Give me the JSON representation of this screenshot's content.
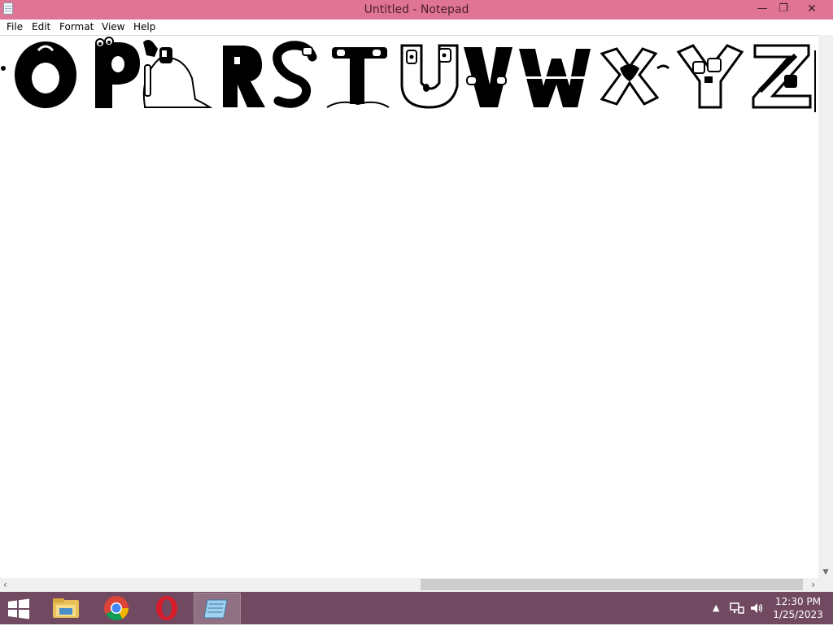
{
  "window": {
    "title": "Untitled - Notepad",
    "app_icon": "notepad-icon",
    "controls": {
      "minimize": "—",
      "maximize": "❐",
      "close": "✕"
    }
  },
  "menu": [
    {
      "label": "File"
    },
    {
      "label": "Edit"
    },
    {
      "label": "Format"
    },
    {
      "label": "View"
    },
    {
      "label": "Help"
    }
  ],
  "editor": {
    "text_alt": "Alphabet lore character images",
    "letters": [
      "O",
      "P",
      "Q",
      "R",
      "S",
      "T",
      "U",
      "V",
      "W",
      "X",
      "Y",
      "Z"
    ]
  },
  "scrollbars": {
    "left_arrow": "‹",
    "right_arrow": "›",
    "down_arrow": "▼"
  },
  "taskbar": {
    "start_icon": "windows-start-icon",
    "apps": [
      {
        "name": "file-explorer-icon"
      },
      {
        "name": "chrome-icon"
      },
      {
        "name": "opera-icon"
      },
      {
        "name": "notepad-icon",
        "active": true
      }
    ],
    "tray": {
      "chevron": "▲",
      "network_icon": "network-icon",
      "volume_icon": "volume-icon"
    },
    "clock": {
      "time": "12:30 PM",
      "date": "1/25/2023"
    }
  },
  "colors": {
    "titlebar": "#e07494",
    "taskbar": "#714a62"
  }
}
